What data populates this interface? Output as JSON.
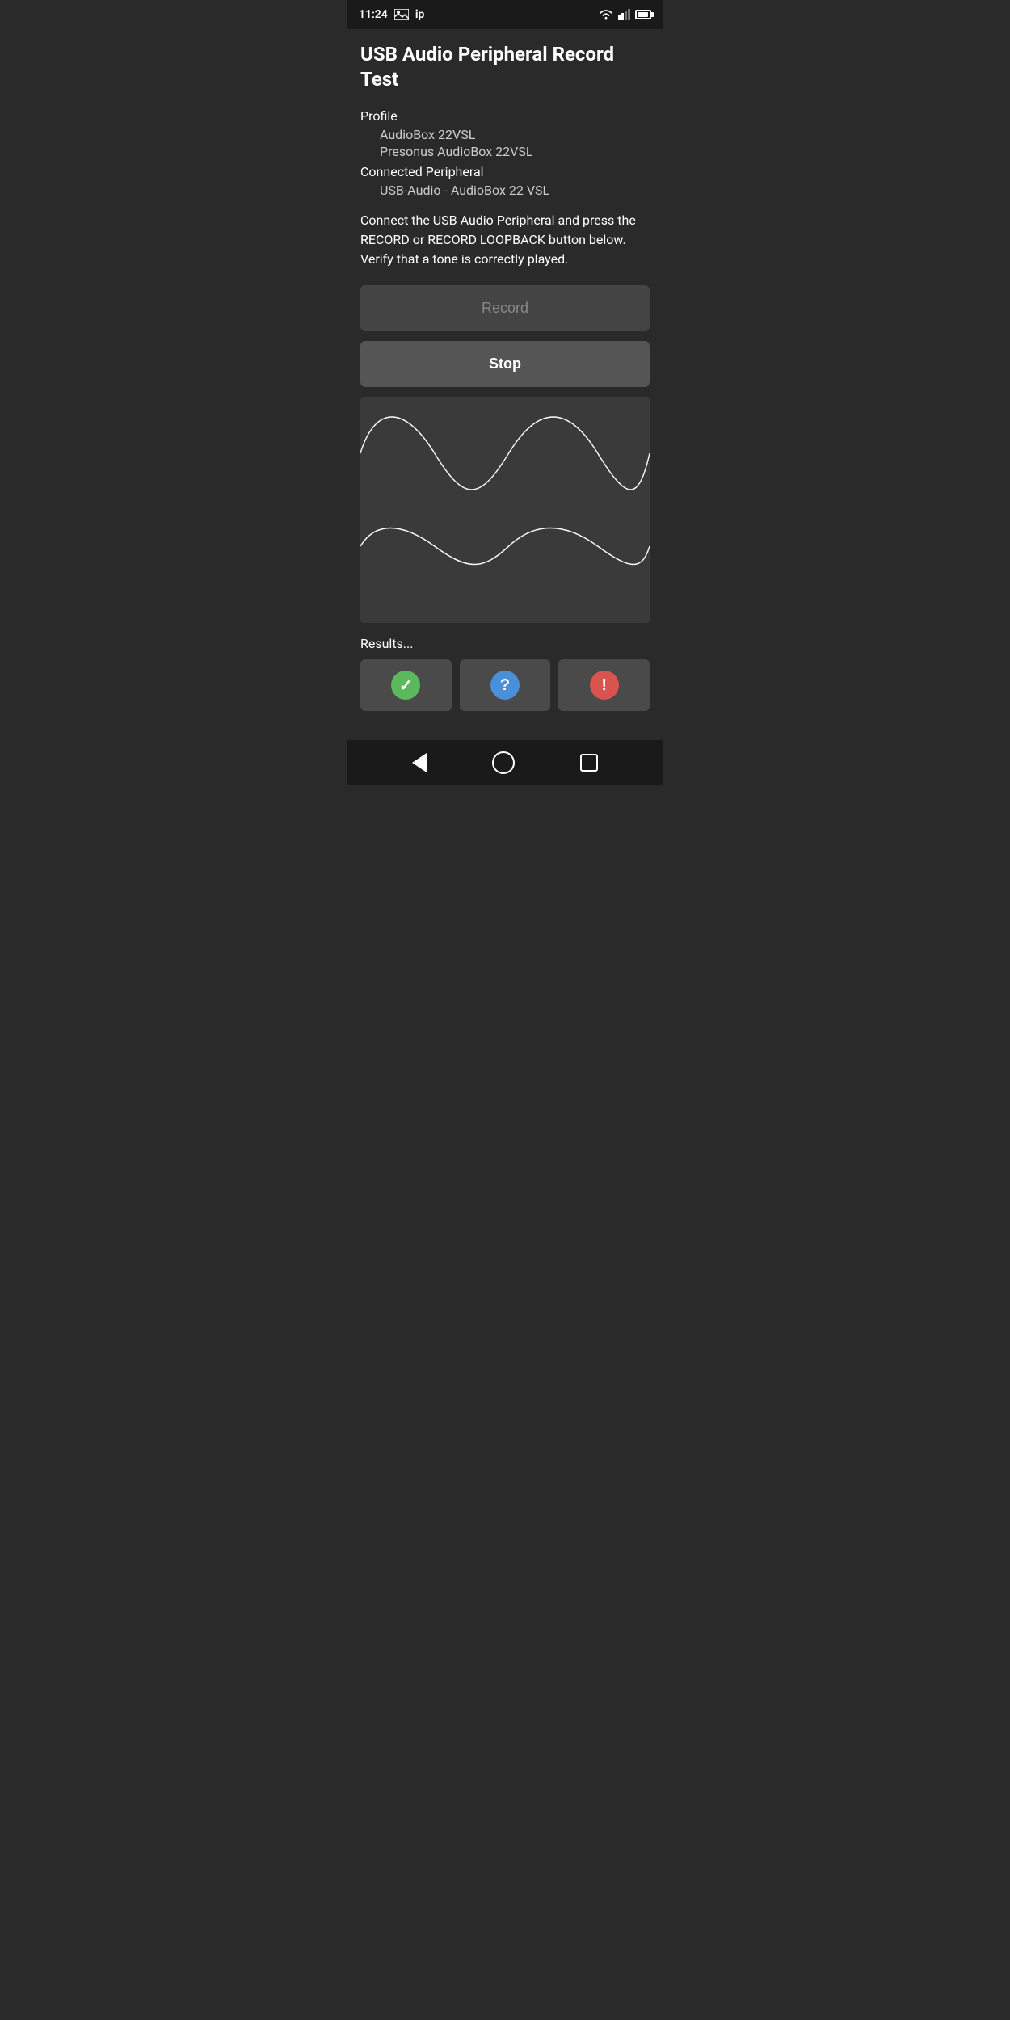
{
  "statusBar": {
    "time": "11:24",
    "icons": [
      "image",
      "ip"
    ]
  },
  "header": {
    "title": "USB Audio Peripheral Record Test"
  },
  "profile": {
    "label": "Profile",
    "items": [
      "AudioBox 22VSL",
      "Presonus AudioBox 22VSL"
    ],
    "connectedLabel": "Connected Peripheral",
    "connectedItem": "USB-Audio - AudioBox 22 VSL"
  },
  "instructions": "Connect the USB Audio Peripheral and press the RECORD or RECORD LOOPBACK button below. Verify that a tone is correctly played.",
  "buttons": {
    "record": "Record",
    "stop": "Stop"
  },
  "results": {
    "label": "Results...",
    "actions": [
      {
        "type": "checkmark",
        "symbol": "✓"
      },
      {
        "type": "question",
        "symbol": "?"
      },
      {
        "type": "exclaim",
        "symbol": "!"
      }
    ]
  }
}
